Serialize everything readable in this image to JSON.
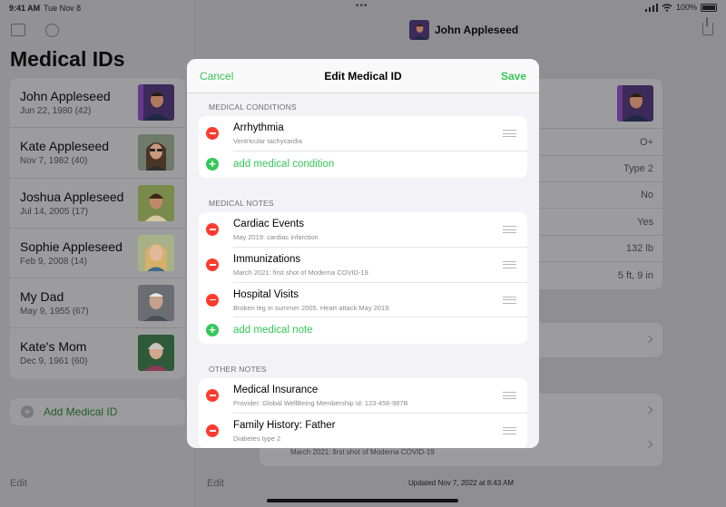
{
  "status_bar": {
    "time": "9:41 AM",
    "date": "Tue Nov 8",
    "battery": "100%",
    "dots": "•••"
  },
  "sidebar": {
    "title": "Medical IDs",
    "people": [
      {
        "name": "John Appleseed",
        "dob": "Jun 22, 1980 (42)"
      },
      {
        "name": "Kate Appleseed",
        "dob": "Nov 7, 1982 (40)"
      },
      {
        "name": "Joshua Appleseed",
        "dob": "Jul 14, 2005 (17)"
      },
      {
        "name": "Sophie Appleseed",
        "dob": "Feb 9, 2008 (14)"
      },
      {
        "name": "My Dad",
        "dob": "May 9, 1955 (67)"
      },
      {
        "name": "Kate's Mom",
        "dob": "Dec 9, 1961 (60)"
      }
    ],
    "add_label": "Add Medical ID",
    "edit_label": "Edit"
  },
  "main": {
    "header_name": "John Appleseed",
    "values": [
      "O+",
      "Type 2",
      "No",
      "Yes",
      "132 lb",
      "5 ft, 9 in"
    ],
    "behind_text": "March 2021: first shot of Moderna COVID-19",
    "edit_label": "Edit",
    "updated": "Updated Nov 7, 2022 at 8:43 AM"
  },
  "sheet": {
    "cancel": "Cancel",
    "title": "Edit Medical ID",
    "save": "Save",
    "sections": {
      "conditions": {
        "header": "MEDICAL CONDITIONS",
        "items": [
          {
            "title": "Arrhythmia",
            "sub": "Ventricular tachycardia"
          }
        ],
        "add": "add medical condition"
      },
      "notes": {
        "header": "MEDICAL NOTES",
        "items": [
          {
            "title": "Cardiac Events",
            "sub": "May 2019: cardiac infarction"
          },
          {
            "title": "Immunizations",
            "sub": "March 2021: first shot of Moderna COVID-19"
          },
          {
            "title": "Hospital Visits",
            "sub": "Broken leg in summer 2005. Heart attack May 2019."
          }
        ],
        "add": "add medical note"
      },
      "other": {
        "header": "OTHER NOTES",
        "items": [
          {
            "title": "Medical Insurance",
            "sub": "Provider: Global WellBeing Membership id: 123-456-987B"
          },
          {
            "title": "Family History: Father",
            "sub": "Diabetes type 2"
          }
        ]
      }
    }
  },
  "colors": {
    "accent": "#34c759",
    "destructive": "#ff3b30",
    "sheet_bg": "#f2f2f7",
    "dim_bg": "#8f8f92"
  }
}
